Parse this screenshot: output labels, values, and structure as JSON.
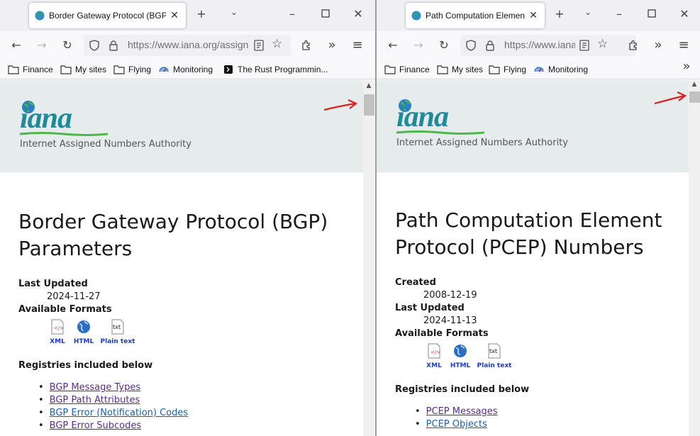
{
  "left": {
    "tab_title": "Border Gateway Protocol (BGP)",
    "url": "https://www.iana.org/assign",
    "bookmarks": [
      "Finance",
      "My sites",
      "Flying",
      "Monitoring",
      "The Rust Programmin..."
    ],
    "logo": "iana",
    "logo_subtitle": "Internet Assigned Numbers Authority",
    "heading_line1": "Border Gateway Protocol (BGP)",
    "heading_line2": "Parameters",
    "meta": [
      {
        "label": "Last Updated",
        "value": "2024-11-27"
      }
    ],
    "formats_label": "Available Formats",
    "formats": [
      "XML",
      "HTML",
      "Plain text"
    ],
    "registries_label": "Registries included below",
    "registries": [
      "BGP Message Types",
      "BGP Path Attributes",
      "BGP Error (Notification) Codes",
      "BGP Error Subcodes"
    ]
  },
  "right": {
    "tab_title": "Path Computation Elemen",
    "url": "https://www.iana",
    "bookmarks": [
      "Finance",
      "My sites",
      "Flying",
      "Monitoring"
    ],
    "logo": "iana",
    "logo_subtitle": "Internet Assigned Numbers Authority",
    "heading_line1": "Path Computation Element",
    "heading_line2": "Protocol (PCEP) Numbers",
    "meta": [
      {
        "label": "Created",
        "value": "2008-12-19"
      },
      {
        "label": "Last Updated",
        "value": "2024-11-13"
      }
    ],
    "formats_label": "Available Formats",
    "formats": [
      "XML",
      "HTML",
      "Plain text"
    ],
    "registries_label": "Registries included below",
    "registries": [
      "PCEP Messages",
      "PCEP Objects"
    ]
  },
  "colors": {
    "link_visited": "#5a2b8f",
    "link": "#1a5fb4",
    "banner": "#e6ecec",
    "logo": "#1e8a9a",
    "annotation_arrow": "#e02020"
  },
  "icons": [
    "globe-favicon",
    "close-icon",
    "new-tab-icon",
    "tab-list-icon",
    "minimize-icon",
    "maximize-icon",
    "window-close-icon",
    "back-icon",
    "forward-icon",
    "reload-icon",
    "shield-icon",
    "lock-icon",
    "reader-icon",
    "star-icon",
    "extensions-icon",
    "overflow-icon",
    "menu-icon",
    "folder-icon",
    "monitoring-icon",
    "rust-book-icon"
  ]
}
